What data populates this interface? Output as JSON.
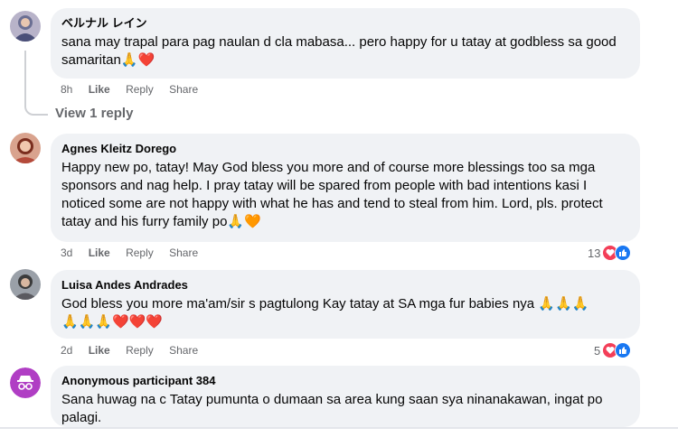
{
  "comments": [
    {
      "author": "ベルナル レイン",
      "text": "sana may trapal para pag naulan d cla mabasa... pero happy for u tatay at godbless sa good samaritan",
      "emojis": "🙏❤️",
      "time": "8h",
      "like": "Like",
      "reply": "Reply",
      "share": "Share",
      "view_replies": "View 1 reply"
    },
    {
      "author": "Agnes Kleitz Dorego",
      "text": "Happy new po, tatay! May God bless you more and of course more blessings too sa mga sponsors and nag help. I pray tatay will be spared from people with bad intentions kasi I noticed some are not happy with what he has and tend to steal from him. Lord, pls. protect tatay and his furry family po",
      "emojis": "🙏🧡",
      "time": "3d",
      "like": "Like",
      "reply": "Reply",
      "share": "Share",
      "reaction_count": "13"
    },
    {
      "author": "Luisa Andes Andrades",
      "text": "God bless you more ma'am/sir s pagtulong Kay tatay at SA mga fur babies nya",
      "emojis_a": "🙏🙏🙏",
      "emojis_b": "🙏🙏🙏❤️❤️❤️",
      "time": "2d",
      "like": "Like",
      "reply": "Reply",
      "share": "Share",
      "reaction_count": "5"
    },
    {
      "author": "Anonymous participant 384",
      "text": "Sana huwag na c Tatay pumunta o dumaan sa area kung saan sya ninanakawan, ingat po palagi."
    }
  ],
  "colors": {
    "bubble": "#f0f2f5",
    "meta": "#65676b",
    "heart": "#f33e58",
    "like": "#1877f2",
    "anon_avatar": "#b03ec4"
  }
}
